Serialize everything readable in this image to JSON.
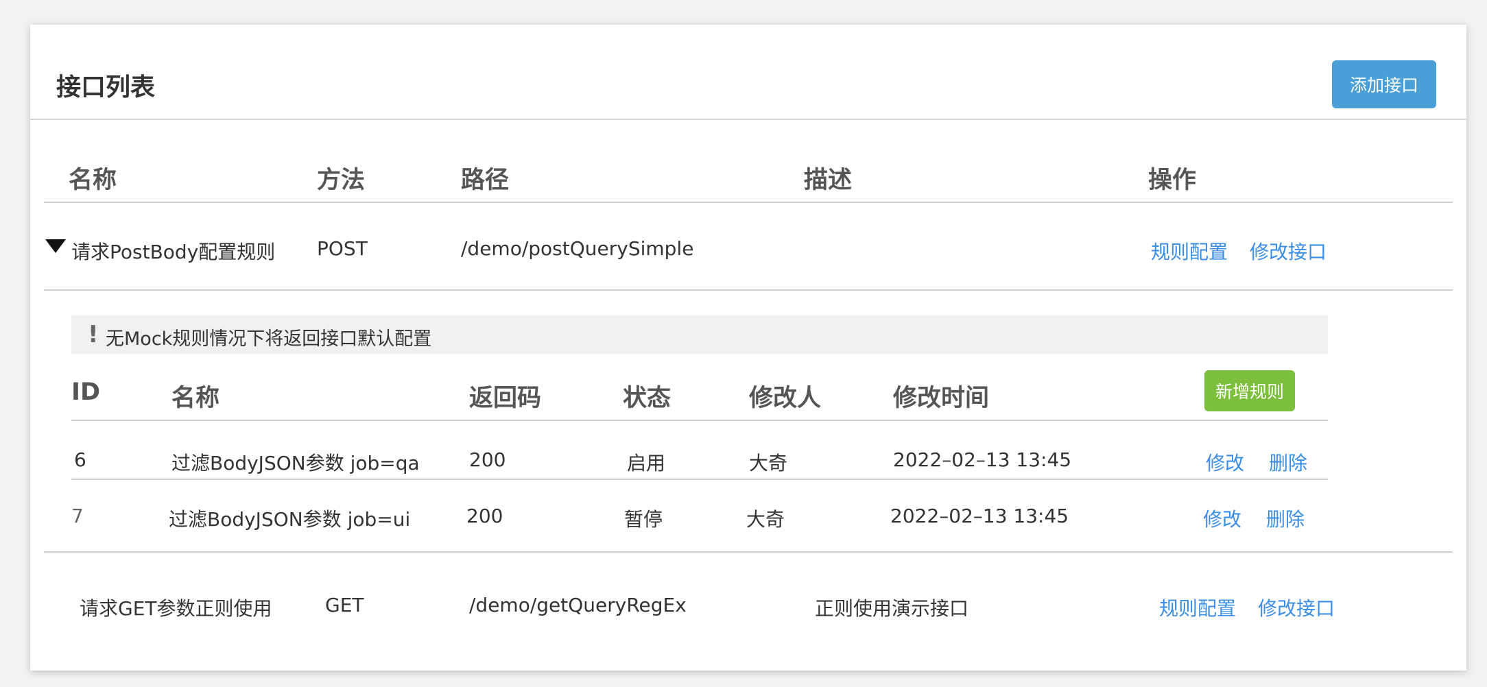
{
  "panel": {
    "title": "接口列表",
    "add_button": "添加接口"
  },
  "columns": {
    "name": "名称",
    "method": "方法",
    "path": "路径",
    "desc": "描述",
    "ops": "操作"
  },
  "apis": [
    {
      "name": "请求PostBody配置规则",
      "method": "POST",
      "path": "/demo/postQuerySimple",
      "desc": "",
      "ops": [
        "规则配置",
        "修改接口"
      ],
      "expanded": true
    },
    {
      "name": "请求GET参数正则使用",
      "method": "GET",
      "path": "/demo/getQueryRegEx",
      "desc": "正则使用演示接口",
      "ops": [
        "规则配置",
        "修改接口"
      ],
      "expanded": false
    }
  ],
  "rules_panel": {
    "notice": "无Mock规则情况下将返回接口默认配置",
    "notice_icon": "exclamation-icon",
    "add_rule_button": "新增规则",
    "columns": {
      "id": "ID",
      "name": "名称",
      "code": "返回码",
      "status": "状态",
      "modifier": "修改人",
      "time": "修改时间"
    },
    "rows": [
      {
        "id": "6",
        "name": "过滤BodyJSON参数 job=qa",
        "code": "200",
        "status": "启用",
        "modifier": "大奇",
        "time": "2022–02–13 13:45",
        "edit": "修改",
        "delete": "删除"
      },
      {
        "id": "7",
        "name": "过滤BodyJSON参数 job=ui",
        "code": "200",
        "status": "暂停",
        "modifier": "大奇",
        "time": "2022–02–13 13:45",
        "edit": "修改",
        "delete": "删除"
      }
    ]
  },
  "colors": {
    "primary": "#4a9fd6",
    "link": "#3a8ee6",
    "success": "#7bbf3c"
  }
}
